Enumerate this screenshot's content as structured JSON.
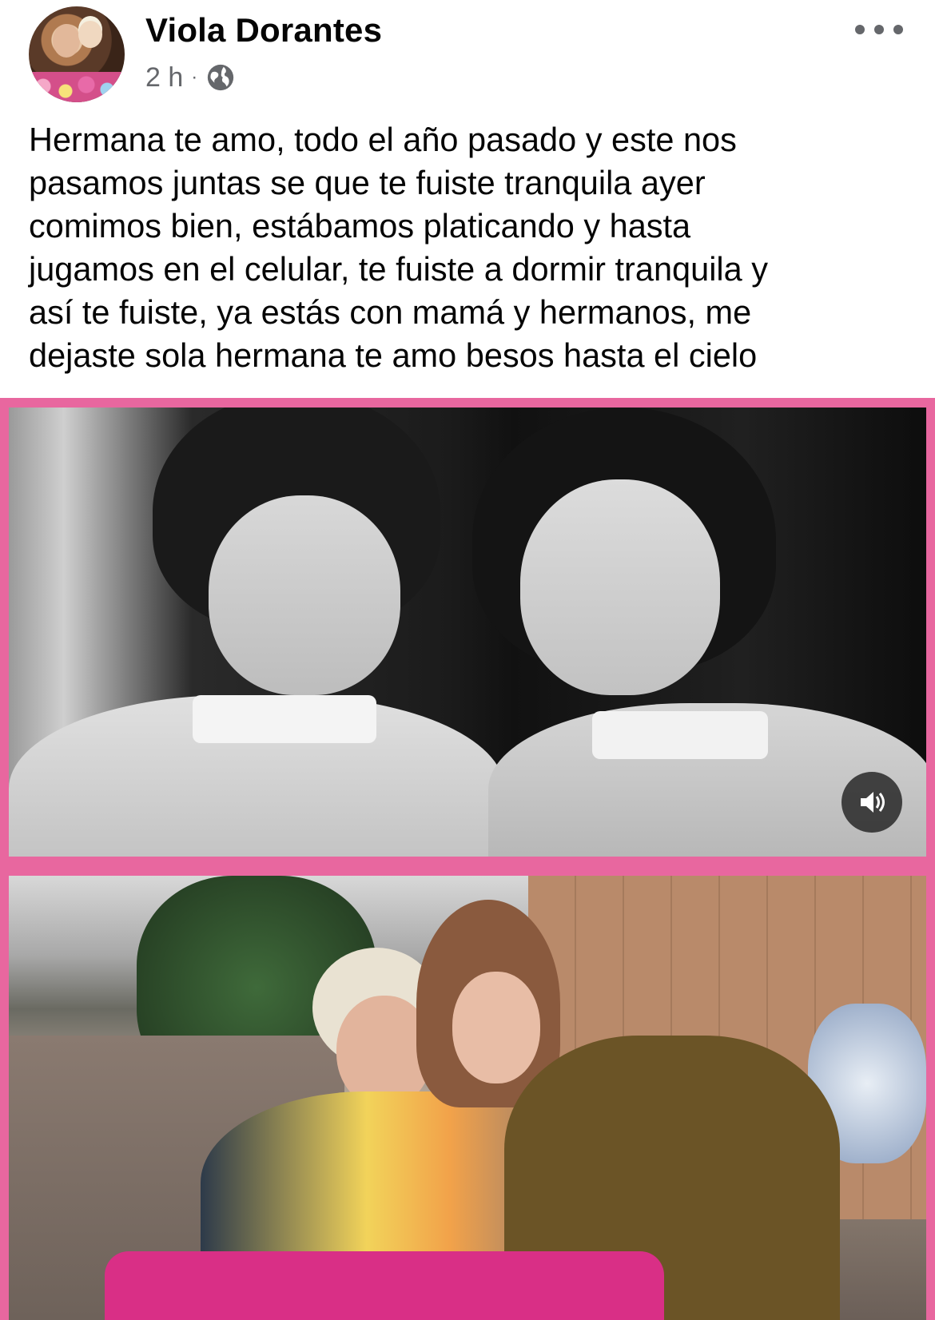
{
  "post": {
    "author": "Viola Dorantes",
    "timestamp": "2 h",
    "separator": "·",
    "audience_icon": "globe-icon",
    "more_icon": "more-horizontal-icon",
    "text": "Hermana te amo, todo el año pasado y este nos\npasamos juntas se que te fuiste tranquila ayer\ncomimos bien, estábamos platicando y hasta\njugamos en el celular, te fuiste a dormir tranquila y\nasí te fuiste, ya estás con mamá y hermanos, me\ndejaste sola hermana te amo besos hasta el cielo"
  },
  "media": {
    "frame_color": "#e8679f",
    "photos": [
      {
        "kind": "video",
        "style": "black-and-white portrait of two women",
        "control_icon": "volume-icon"
      },
      {
        "kind": "photo",
        "style": "color photo of two older women embracing at a table"
      }
    ]
  }
}
